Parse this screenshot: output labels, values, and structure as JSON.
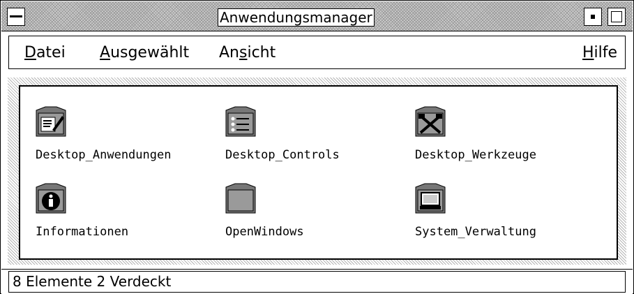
{
  "window": {
    "title": "Anwendungsmanager"
  },
  "menubar": {
    "items": [
      {
        "pre": "",
        "key": "D",
        "post": "atei"
      },
      {
        "pre": "",
        "key": "A",
        "post": "usgewählt"
      },
      {
        "pre": "An",
        "key": "s",
        "post": "icht"
      },
      {
        "pre": "",
        "key": "H",
        "post": "ilfe"
      }
    ]
  },
  "content": {
    "icons": [
      {
        "label": "Desktop_Anwendungen",
        "icon": "folder-edit-icon"
      },
      {
        "label": "Desktop_Controls",
        "icon": "folder-controls-icon"
      },
      {
        "label": "Desktop_Werkzeuge",
        "icon": "folder-tools-icon"
      },
      {
        "label": "Informationen",
        "icon": "folder-info-icon"
      },
      {
        "label": "OpenWindows",
        "icon": "folder-icon"
      },
      {
        "label": "System_Verwaltung",
        "icon": "folder-computer-icon"
      }
    ]
  },
  "statusbar": {
    "text": "8 Elemente 2 Verdeckt"
  },
  "colors": {
    "window_bg": "#ffffff",
    "titlebar_pattern": "#9a9a9a",
    "border": "#000000"
  }
}
